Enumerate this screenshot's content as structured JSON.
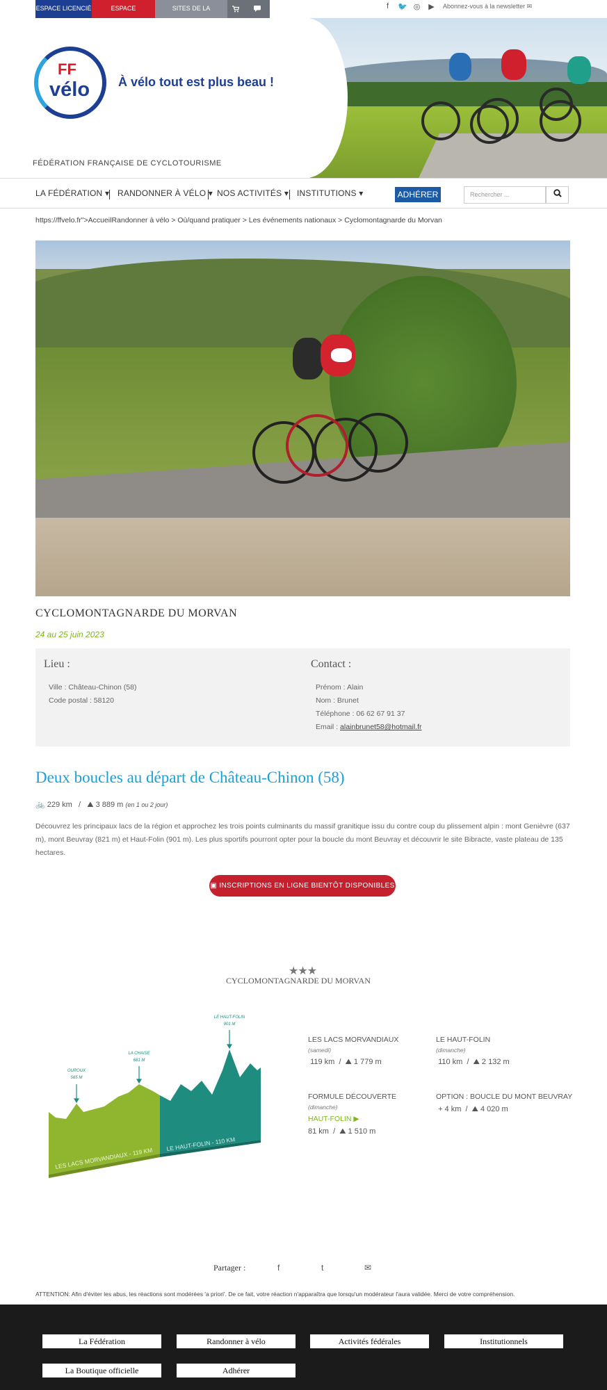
{
  "topbar": {
    "espace_licencie": "ESPACE LICENCIÉ",
    "espace_structures": "ESPACE STRUCTURES",
    "sites_federation": "SITES DE LA FÉDÉRATION ▾",
    "cart_icon": "cart-icon",
    "chat_icon": "chat-icon",
    "newsletter": "Abonnez-vous à la newsletter ✉",
    "social": [
      "facebook-icon",
      "twitter-icon",
      "instagram-icon",
      "youtube-icon"
    ]
  },
  "header": {
    "logo_ff": "FF",
    "logo_velo": "vélo",
    "slogan": "À vélo tout est plus beau !",
    "federation": "FÉDÉRATION FRANÇAISE DE CYCLOTOURISME"
  },
  "nav": {
    "items": [
      "LA FÉDÉRATION",
      "RANDONNER À VÉLO",
      "NOS ACTIVITÉS",
      "INSTITUTIONS"
    ],
    "adherer": "ADHÉRER",
    "search_placeholder": "Rechercher ..."
  },
  "breadcrumb": "https://ffvelo.fr\">AccueilRandonner à vélo > Où/quand pratiquer > Les événements nationaux > Cyclomontagnarde du Morvan",
  "event": {
    "title": "CYCLOMONTAGNARDE DU MORVAN",
    "date": "24 au 25 juin 2023"
  },
  "lieu": {
    "heading": "Lieu :",
    "ville": "Ville : Château-Chinon (58)",
    "code_postal": "Code postal : 58120"
  },
  "contact": {
    "heading": "Contact :",
    "prenom": "Prénom : Alain",
    "nom": "Nom : Brunet",
    "telephone": "Téléphone : 06 62 67 91 37",
    "email_label": "Email : ",
    "email": "alainbrunet58@hotmail.fr"
  },
  "section": {
    "title": "Deux boucles au départ de Château-Chinon (58)",
    "distance": "229 km",
    "elevation": "3 889 m",
    "elevation_note": "(en 1 ou 2 jour)",
    "description": "Découvrez les principaux lacs de la région et approchez les trois points culminants du massif granitique issu du contre coup du plissement alpin : mont Genièvre (637 m), mont Beuvray (821 m) et Haut-Folin (901 m). Les plus sportifs pourront opter pour la boucle du mont Beuvray et découvrir le site Bibracte, vaste plateau de 135 hectares.",
    "inscriptions": "INSCRIPTIONS EN LIGNE BIENTÔT DISPONIBLES !"
  },
  "route": {
    "stars": "★★★",
    "title": "CYCLOMONTAGNARDE DU MORVAN",
    "profile_labels": {
      "ouroux": "OUROUX",
      "ouroux_alt": "565 M",
      "chaise": "LA CHAISE",
      "chaise_alt": "681 M",
      "haut_folin": "LE HAUT-FOLIN",
      "haut_folin_alt": "901 M",
      "lacs_band": "LES LACS MORVANDIAUX - 119 KM",
      "folin_band": "LE HAUT-FOLIN - 110 KM"
    },
    "blocks": [
      {
        "name": "LES LACS MORVANDIAUX",
        "day": "(samedi)",
        "km": "119 km",
        "elev": "1 779 m"
      },
      {
        "name": "LE HAUT-FOLIN",
        "day": "(dimanche)",
        "km": "110 km",
        "elev": "2 132 m"
      },
      {
        "name": "FORMULE DÉCOUVERTE",
        "day": "(dimanche)",
        "highlight": "HAUT-FOLIN ▶",
        "km": "81 km",
        "elev": "1 510 m"
      },
      {
        "name": "OPTION : BOUCLE DU MONT BEUVRAY",
        "km": "+ 4 km",
        "elev": "4 020 m"
      }
    ]
  },
  "share": {
    "label": "Partager :",
    "icons": [
      "facebook-icon",
      "twitter-icon",
      "mail-icon"
    ]
  },
  "attention": "ATTENTION: Afin d'éviter les abus, les réactions sont modérées 'a priori'. De ce fait, votre réaction n'apparaîtra que lorsqu'un modérateur l'aura validée. Merci de votre compréhension.",
  "footer": {
    "links": [
      "La Fédération",
      "Randonner à vélo",
      "Activités fédérales",
      "Institutionnels",
      "La Boutique officielle",
      "Adhérer"
    ]
  },
  "colors": {
    "brand_blue": "#1c3f94",
    "brand_red": "#d0202e",
    "accent_green": "#7fb61c",
    "title_blue": "#1aa0d8"
  }
}
